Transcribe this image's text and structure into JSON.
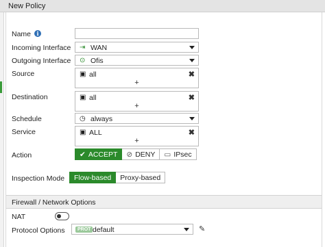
{
  "dialog": {
    "title": "New Policy"
  },
  "form": {
    "name": {
      "label": "Name",
      "value": ""
    },
    "incoming_interface": {
      "label": "Incoming Interface",
      "value": "WAN",
      "icon": "wan-port-icon"
    },
    "outgoing_interface": {
      "label": "Outgoing Interface",
      "value": "Ofis",
      "icon": "network-port-icon"
    },
    "source": {
      "label": "Source",
      "value": "all",
      "icon": "address-icon",
      "add": "+",
      "remove": "✖"
    },
    "destination": {
      "label": "Destination",
      "value": "all",
      "icon": "address-icon",
      "add": "+",
      "remove": "✖"
    },
    "schedule": {
      "label": "Schedule",
      "value": "always",
      "icon": "schedule-icon"
    },
    "service": {
      "label": "Service",
      "value": "ALL",
      "icon": "service-icon",
      "add": "+",
      "remove": "✖"
    },
    "action": {
      "label": "Action",
      "options": [
        {
          "label": "ACCEPT",
          "icon": "check-icon",
          "active": true
        },
        {
          "label": "DENY",
          "icon": "deny-icon",
          "active": false
        },
        {
          "label": "IPsec",
          "icon": "ipsec-icon",
          "active": false
        }
      ]
    },
    "inspection_mode": {
      "label": "Inspection Mode",
      "options": [
        {
          "label": "Flow-based",
          "active": true
        },
        {
          "label": "Proxy-based",
          "active": false
        }
      ]
    }
  },
  "firewall_section": {
    "title": "Firewall / Network Options",
    "nat": {
      "label": "NAT",
      "enabled": false
    },
    "protocol_options": {
      "label": "Protocol Options",
      "badge": "PROT",
      "value": "default"
    }
  },
  "colors": {
    "accent": "#2b8a2b",
    "info": "#2f6fb5"
  }
}
